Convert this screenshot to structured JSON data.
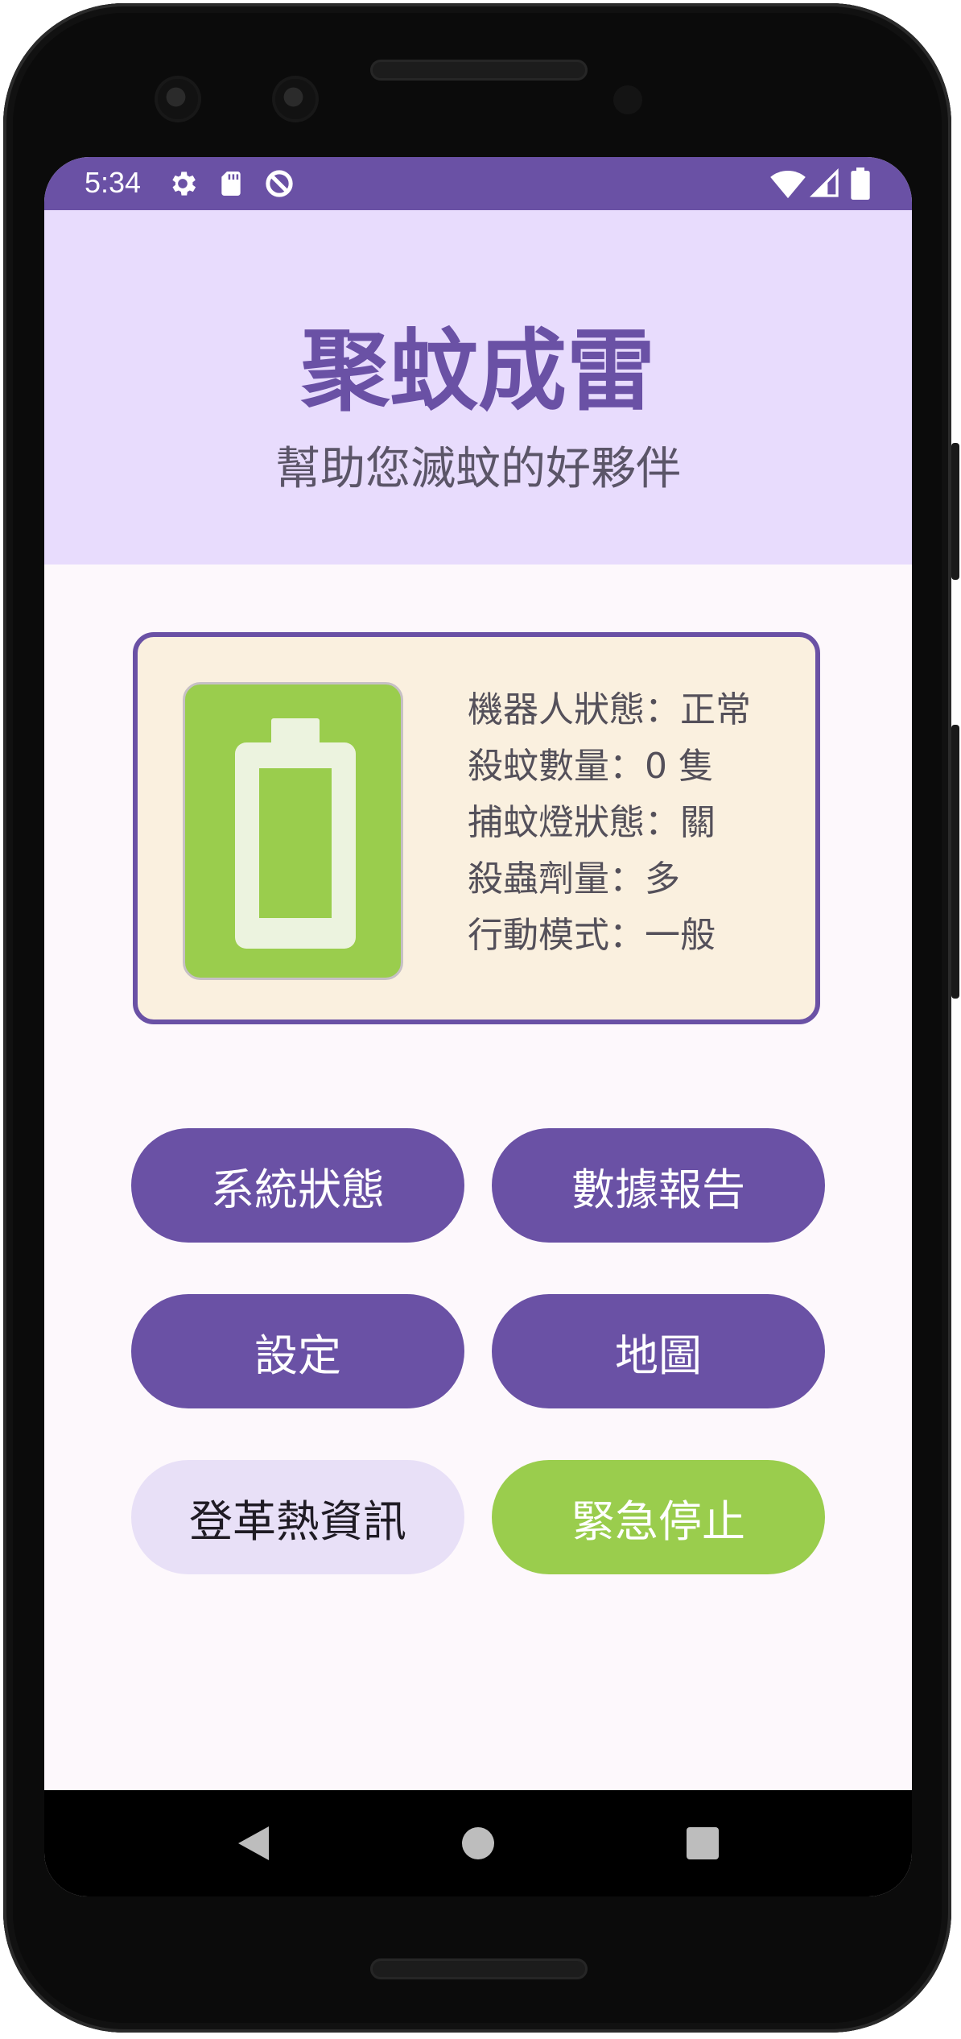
{
  "status_bar": {
    "time": "5:34",
    "icons_left": [
      "gear-icon",
      "sd-card-icon",
      "data-saver-icon"
    ],
    "icons_right": [
      "wifi-icon",
      "signal-icon",
      "battery-icon"
    ],
    "background": "#6a51a5"
  },
  "header": {
    "title": "聚蚊成雷",
    "subtitle": "幫助您滅蚊的好夥伴",
    "background": "#e8dcfd",
    "title_color": "#6a51a5"
  },
  "status_card": {
    "icon": "battery-icon",
    "icon_background": "#9acd4d",
    "lines": [
      "機器人狀態：正常",
      "殺蚊數量：0 隻",
      "捕蚊燈狀態：關",
      "殺蟲劑量：多",
      "行動模式：一般"
    ],
    "border_color": "#6a51a5",
    "background": "#faf0df"
  },
  "buttons": {
    "system_status": "系統狀態",
    "data_report": "數據報告",
    "settings": "設定",
    "map": "地圖",
    "dengue_info": "登革熱資訊",
    "emergency_stop": "緊急停止"
  },
  "colors": {
    "primary": "#6a51a5",
    "secondary_button": "#e8e0f7",
    "emergency": "#9acd4d"
  },
  "nav_bar": {
    "icons": [
      "back-icon",
      "home-icon",
      "recents-icon"
    ]
  }
}
